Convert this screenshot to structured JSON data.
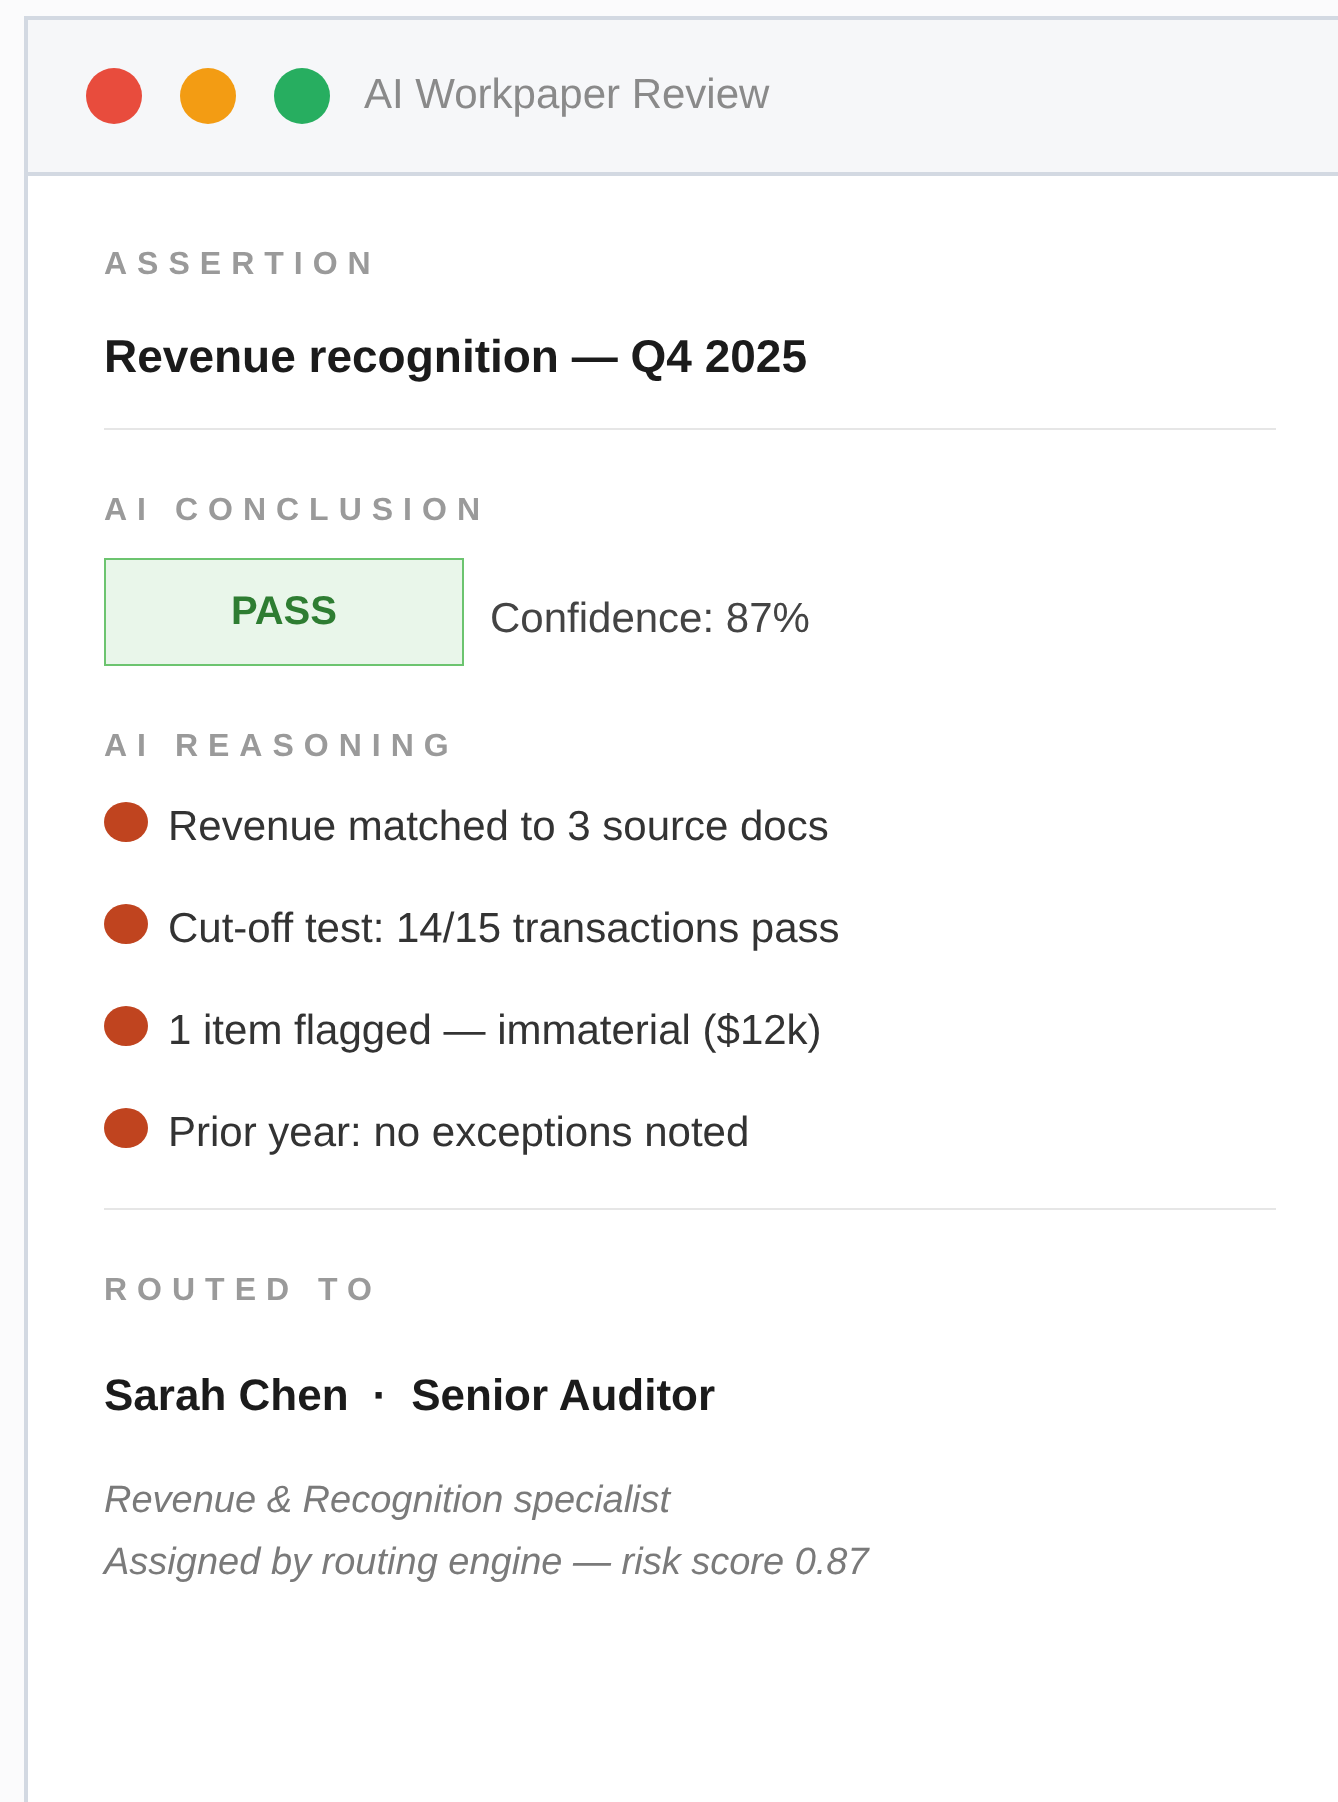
{
  "window": {
    "title": "AI Workpaper Review"
  },
  "assertion": {
    "label": "ASSERTION",
    "value": "Revenue recognition — Q4 2025"
  },
  "conclusion": {
    "label": "AI CONCLUSION",
    "kind": "pass",
    "verdict": "PASS",
    "confidence": "Confidence: 87%"
  },
  "reasoning": {
    "label": "AI REASONING",
    "items": [
      {
        "text": "Revenue matched to 3 source docs"
      },
      {
        "text": "Cut-off test: 14/15 transactions pass"
      },
      {
        "text": "1 item flagged — immaterial ($12k)"
      },
      {
        "text": "Prior year: no exceptions noted"
      }
    ]
  },
  "routed": {
    "label": "ROUTED TO",
    "name": "Sarah Chen",
    "separator": "·",
    "role": "Senior Auditor",
    "notes": [
      "Revenue & Recognition specialist",
      "Assigned by routing engine — risk score 0.87"
    ]
  }
}
